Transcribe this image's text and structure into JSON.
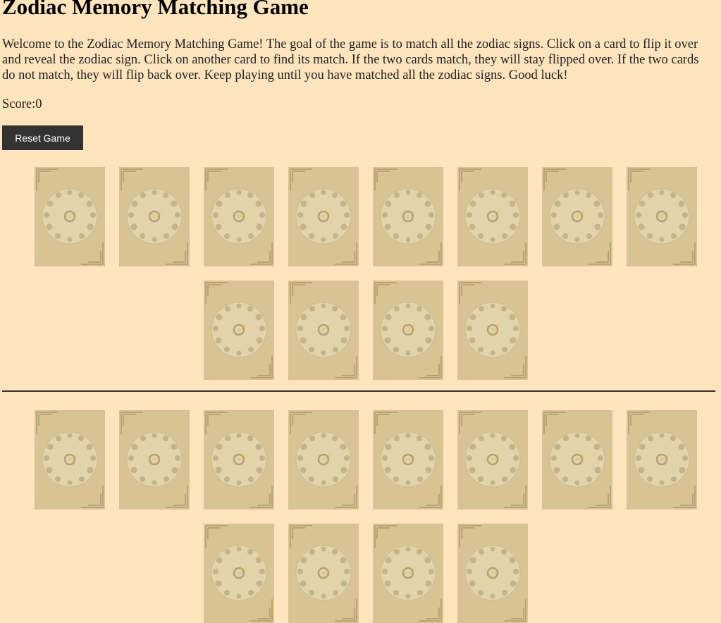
{
  "title": "Zodiac Memory Matching Game",
  "intro": "Welcome to the Zodiac Memory Matching Game! The goal of the game is to match all the zodiac signs. Click on a card to flip it over and reveal the zodiac sign. Click on another card to find its match. If the two cards match, they will stay flipped over. If the two cards do not match, they will flip back over. Keep playing until you have matched all the zodiac signs. Good luck!",
  "score_label": "Score:",
  "score_value": "0",
  "reset_label": "Reset Game",
  "card_back_icon": "zodiac-wheel-card-back-icon",
  "colors": {
    "background": "#ffe4bd",
    "card": "#d7c394",
    "button": "#333333",
    "button_text": "#ffffff"
  },
  "grids": [
    {
      "name": "card-grid-1",
      "card_count": 12,
      "state": "face-down"
    },
    {
      "name": "card-grid-2",
      "card_count": 12,
      "state": "face-down"
    }
  ]
}
